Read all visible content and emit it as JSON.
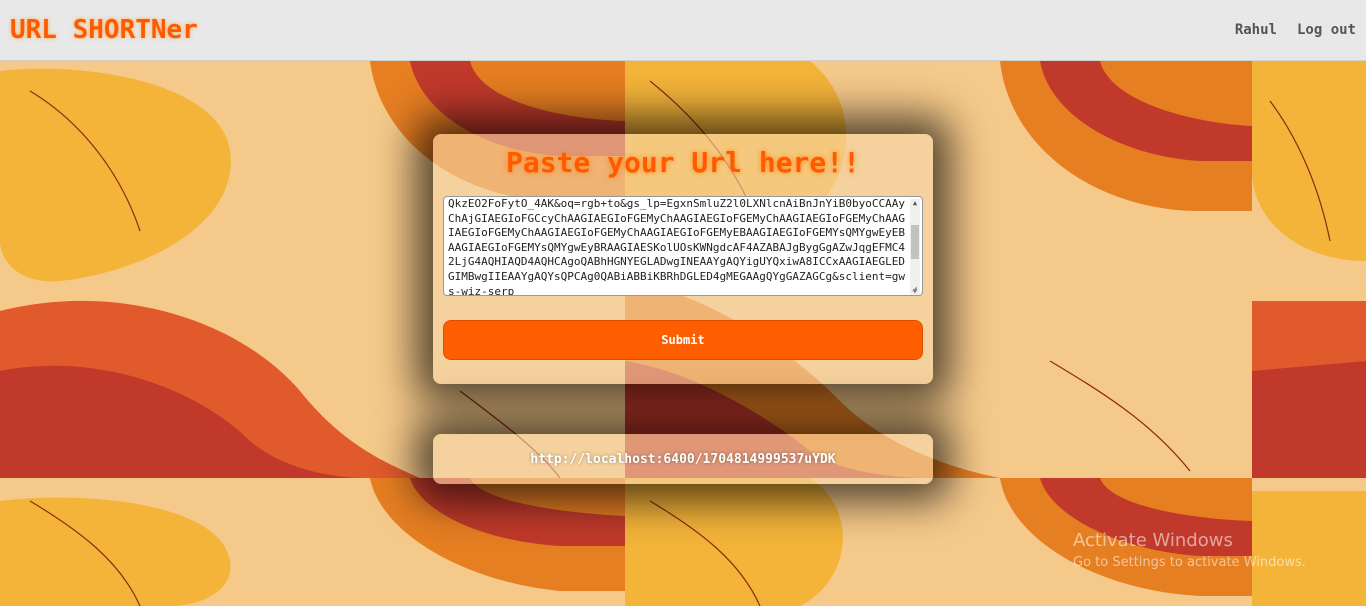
{
  "navbar": {
    "brand": "URL SHORTNer",
    "user_link": "Rahul",
    "logout_link": "Log out"
  },
  "form": {
    "heading": "Paste your Url here!!",
    "url_value": "QkzEO2FoFytO_4AK&oq=rgb+to&gs_lp=EgxnSmluZ2l0LXNlcnAiBnJnYiB0byoCCAAyChAjGIAEGIoFGCcyChAAGIAEGIoFGEMyChAAGIAEGIoFGEMyChAAGIAEGIoFGEMyChAAGIAEGIoFGEMyChAAGIAEGIoFGEMyChAAGIAEGIoFGEMyEBAAGIAEGIoFGEMYsQMYgwEyEBAAGIAEGIoFGEMYsQMYgwEyBRAAGIAESKolUOsKWNgdcAF4AZABAJgBygGgAZwJqgEFMC42LjG4AQHIAQD4AQHCAgoQABhHGNYEGLADwgINEAAYgAQYigUYQxiwA8ICCxAAGIAEGLEDGIMBwgIIEAAYgAQYsQPCAg0QABiABBiKBRhDGLED4gMEGAAgQYgGAZAGCg&sclient=gws-wiz-serp",
    "submit_label": "Submit"
  },
  "result": {
    "short_url": "http://localhost:6400/1704814999537uYDK"
  },
  "watermark": {
    "title": "Activate Windows",
    "subtitle": "Go to Settings to activate Windows."
  },
  "colors": {
    "accent": "#ff5e00",
    "background": "#f5c98a"
  }
}
